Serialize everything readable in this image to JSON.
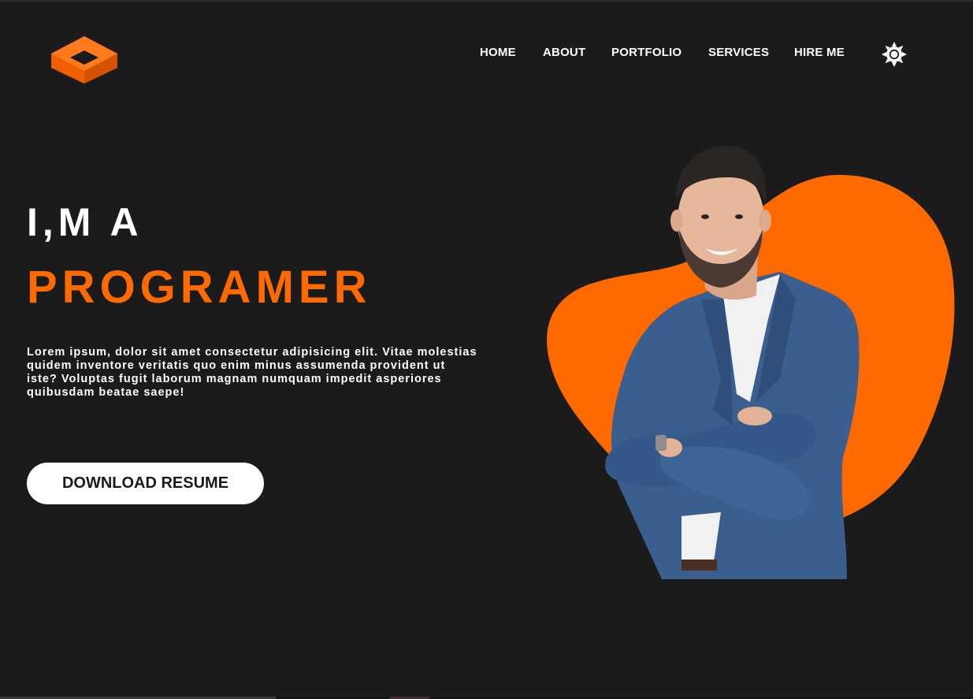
{
  "brand": {
    "logo_icon": "orange-isometric-box-logo",
    "accent_color": "#ff6a00"
  },
  "nav": {
    "items": [
      {
        "label": "HOME"
      },
      {
        "label": "ABOUT"
      },
      {
        "label": "PORTFOLIO"
      },
      {
        "label": "SERVICES"
      },
      {
        "label": "HIRE ME"
      }
    ],
    "theme_toggle_icon": "sun-icon"
  },
  "hero": {
    "line1": "I,M A",
    "line2": "PROGRAMER",
    "description": "Lorem ipsum, dolor sit amet consectetur adipisicing elit. Vitae molestias quidem inventore veritatis quo enim minus assumenda provident ut iste? Voluptas fugit laborum magnam numquam impedit asperiores quibusdam beatae saepe!",
    "button_label": "DOWNLOAD RESUME",
    "portrait": "man-in-blue-suit-arms-crossed",
    "blob_color": "#ff6a00"
  },
  "theme": {
    "background": "#1b1b1c",
    "text_color": "#ffffff"
  }
}
